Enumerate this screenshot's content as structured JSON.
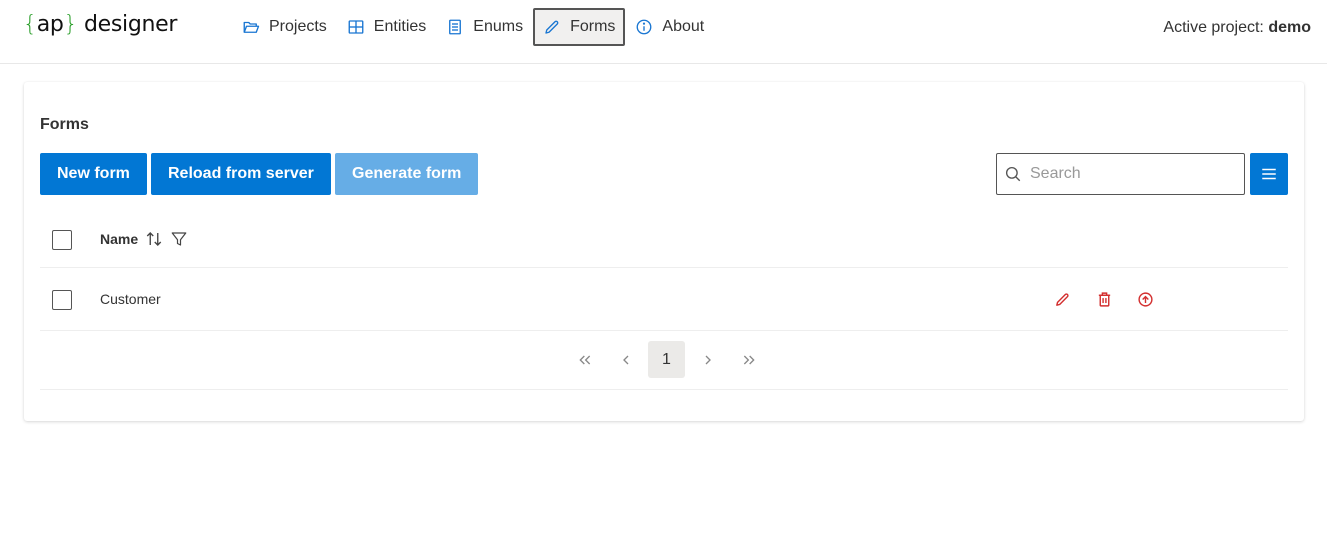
{
  "header": {
    "logo": {
      "open_brace": "{",
      "name": "ap",
      "close_brace": "}",
      "suffix": " designer"
    },
    "nav": [
      {
        "label": "Projects",
        "icon": "folder-open-icon",
        "active": false
      },
      {
        "label": "Entities",
        "icon": "table-grid-icon",
        "active": false
      },
      {
        "label": "Enums",
        "icon": "list-book-icon",
        "active": false
      },
      {
        "label": "Forms",
        "icon": "pencil-icon",
        "active": true
      },
      {
        "label": "About",
        "icon": "info-circle-icon",
        "active": false
      }
    ],
    "active_project_label": "Active project: ",
    "active_project_value": "demo"
  },
  "forms_panel": {
    "title": "Forms",
    "toolbar": {
      "new_form": "New form",
      "reload": "Reload from server",
      "generate": "Generate form",
      "generate_disabled": true,
      "search_placeholder": "Search",
      "search_value": "",
      "menu_icon": "hamburger-icon"
    },
    "table": {
      "columns": [
        {
          "label": "Name",
          "sortable": true,
          "filterable": true
        }
      ],
      "rows": [
        {
          "name": "Customer",
          "actions": [
            "edit-icon",
            "delete-icon",
            "publish-icon"
          ]
        }
      ]
    },
    "pagination": {
      "first": "«",
      "prev": "‹",
      "pages": [
        "1"
      ],
      "current": "1",
      "next": "›",
      "last": "»"
    }
  },
  "colors": {
    "primary": "#0277d4",
    "primary_disabled": "#66ade6",
    "logo_brace": "#2ea02e",
    "danger": "#d32f2f",
    "nav_icon": "#1976d2"
  }
}
